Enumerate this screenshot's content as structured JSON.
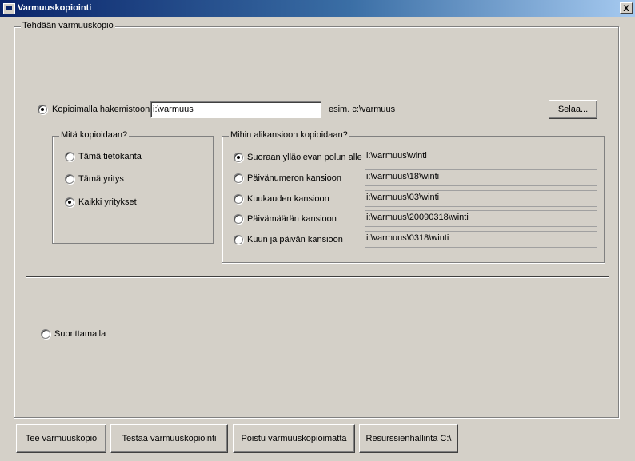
{
  "window": {
    "title": "Varmuuskopiointi",
    "close_label": "X"
  },
  "main_group": {
    "label": "Tehdään varmuuskopio"
  },
  "copy_dir": {
    "label": "Kopioimalla hakemistoon",
    "value": "i:\\varmuus",
    "example": "esim. c:\\varmuus",
    "browse_label": "Selaa...",
    "selected": true
  },
  "what_group": {
    "label": "Mitä kopioidaan?",
    "options": [
      {
        "label": "Tämä tietokanta",
        "checked": false
      },
      {
        "label": "Tämä yritys",
        "checked": false
      },
      {
        "label": "Kaikki yritykset",
        "checked": true
      }
    ]
  },
  "sub_group": {
    "label": "Mihin alikansioon kopioidaan?",
    "options": [
      {
        "label": "Suoraan ylläolevan polun alle",
        "path": "i:\\varmuus\\winti",
        "checked": true
      },
      {
        "label": "Päivänumeron kansioon",
        "path": "i:\\varmuus\\18\\winti",
        "checked": false
      },
      {
        "label": "Kuukauden kansioon",
        "path": "i:\\varmuus\\03\\winti",
        "checked": false
      },
      {
        "label": "Päivämäärän kansioon",
        "path": "i:\\varmuus\\20090318\\winti",
        "checked": false
      },
      {
        "label": "Kuun ja päivän kansioon",
        "path": "i:\\varmuus\\0318\\winti",
        "checked": false
      }
    ]
  },
  "execute": {
    "label": "Suorittamalla",
    "selected": false
  },
  "buttons": {
    "make_backup": "Tee varmuuskopio",
    "test_backup": "Testaa varmuuskopiointi",
    "exit": "Poistu varmuuskopioimatta",
    "explorer": "Resurssienhallinta C:\\"
  }
}
